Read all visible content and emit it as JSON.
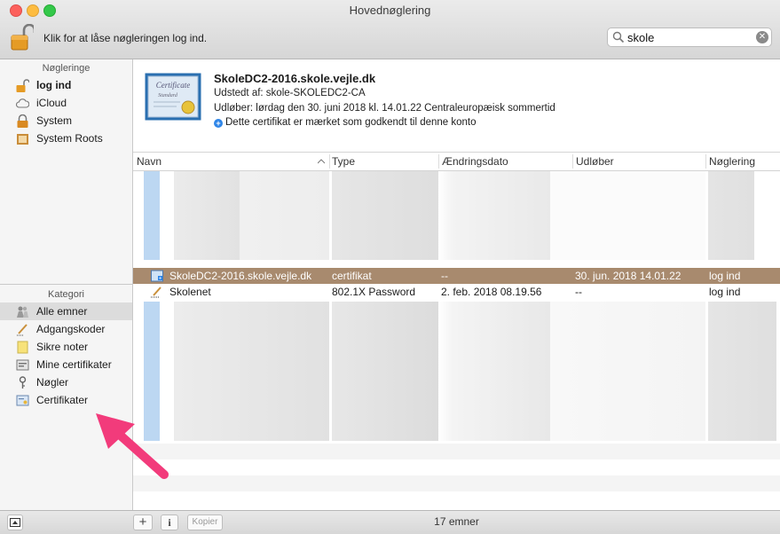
{
  "window": {
    "title": "Hovednøglering"
  },
  "toolbar": {
    "lock_text": "Klik for at låse nøgleringen log ind.",
    "search_value": "skole"
  },
  "sidebar": {
    "keychains_header": "Nøgleringe",
    "keychains": [
      {
        "label": "log ind",
        "icon": "lock-open-icon"
      },
      {
        "label": "iCloud",
        "icon": "cloud-icon"
      },
      {
        "label": "System",
        "icon": "lock-icon"
      },
      {
        "label": "System Roots",
        "icon": "folder-icon"
      }
    ],
    "category_header": "Kategori",
    "categories": [
      {
        "label": "Alle emner",
        "icon": "people-icon"
      },
      {
        "label": "Adgangskoder",
        "icon": "pen-icon"
      },
      {
        "label": "Sikre noter",
        "icon": "note-icon"
      },
      {
        "label": "Mine certifikater",
        "icon": "my-cert-icon"
      },
      {
        "label": "Nøgler",
        "icon": "key-icon"
      },
      {
        "label": "Certifikater",
        "icon": "certificate-icon"
      }
    ]
  },
  "cert": {
    "image_lettering": "Certificate Standard",
    "title": "SkoleDC2-2016.skole.vejle.dk",
    "issuer": "Udstedt af: skole-SKOLEDC2-CA",
    "expires": "Udløber: lørdag den 30. juni 2018 kl. 14.01.22 Centraleuropæisk sommertid",
    "trust": "Dette certifikat er mærket som godkendt til denne konto"
  },
  "table": {
    "columns": [
      "Navn",
      "Type",
      "Ændringsdato",
      "Udløber",
      "Nøglering"
    ],
    "rows": [
      {
        "name": "SkoleDC2-2016.skole.vejle.dk",
        "type": "certifikat",
        "modified": "--",
        "expires": "30. jun. 2018 14.01.22",
        "keychain": "log ind",
        "icon": "certificate-icon"
      },
      {
        "name": "Skolenet",
        "type": "802.1X Password",
        "modified": "2. feb. 2018 08.19.56",
        "expires": "--",
        "keychain": "log ind",
        "icon": "pen-icon"
      }
    ]
  },
  "bottom": {
    "add": "+",
    "info": "i",
    "copy": "Kopier",
    "count": "17 emner"
  },
  "colors": {
    "selection": "#a88a6e",
    "annotation_arrow": "#f23b7b"
  }
}
